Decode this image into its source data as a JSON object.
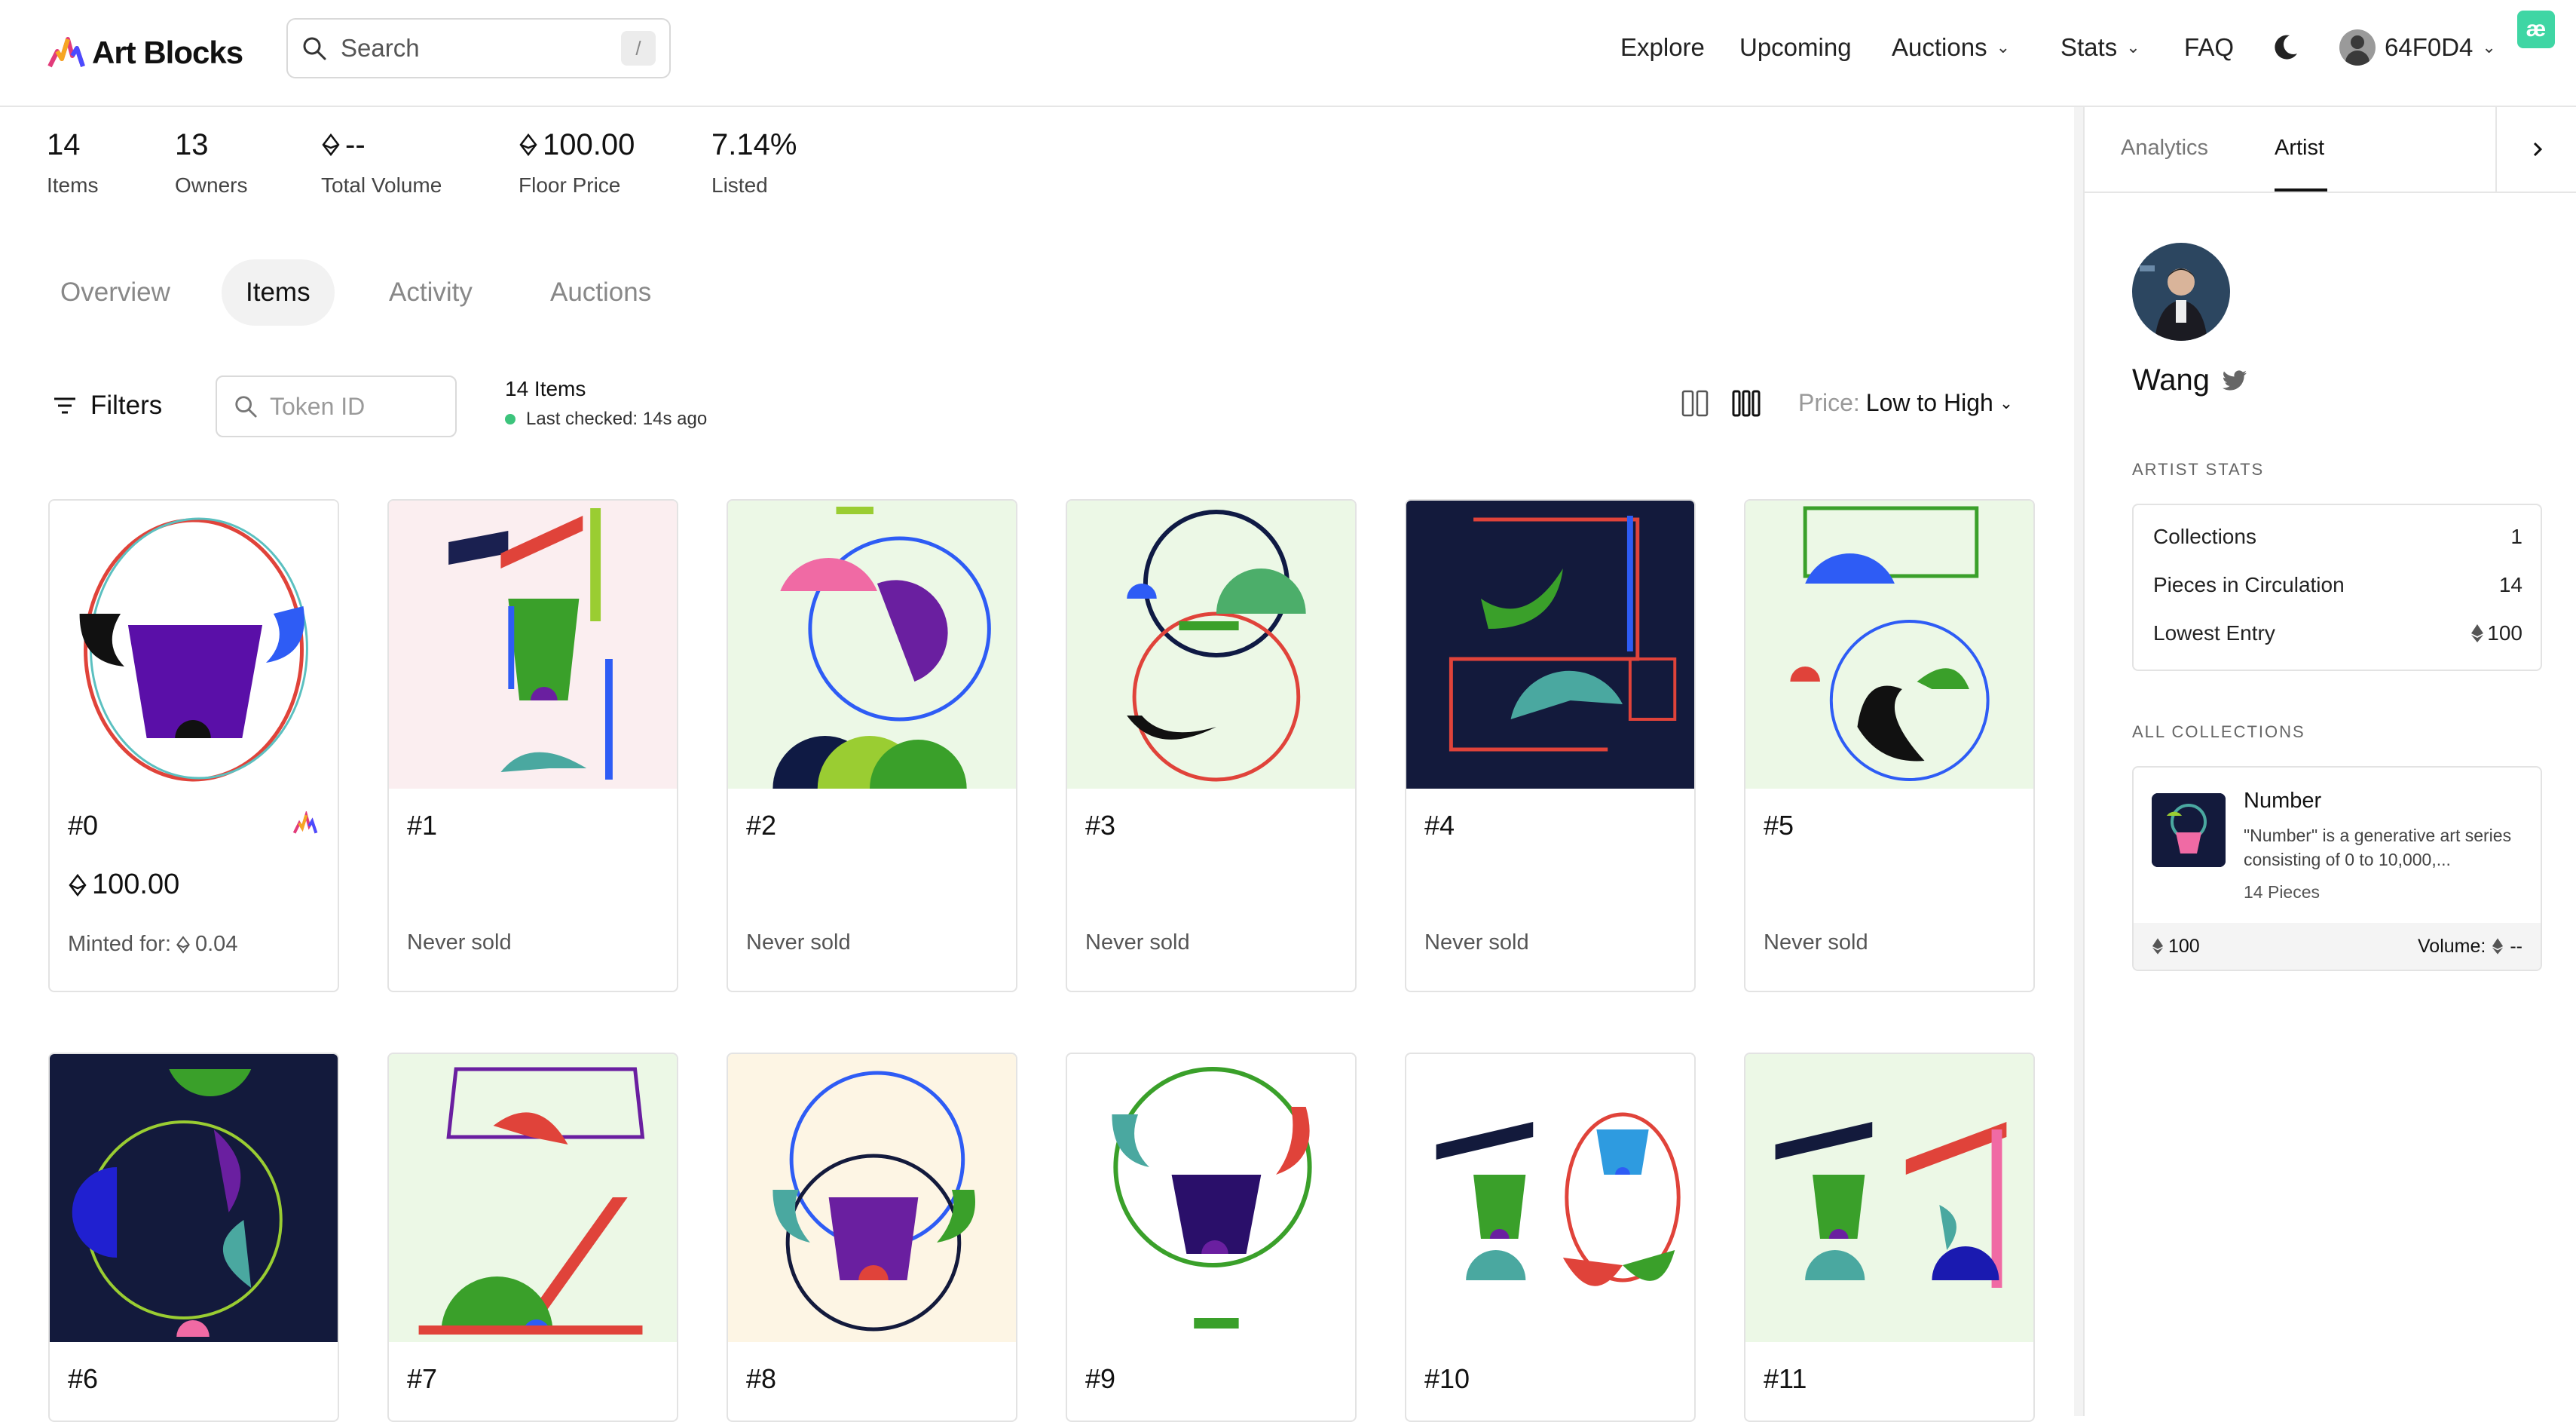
{
  "brand": {
    "name": "Art Blocks"
  },
  "search": {
    "placeholder": "Search",
    "shortcut": "/"
  },
  "nav": {
    "explore": "Explore",
    "upcoming": "Upcoming",
    "auctions": "Auctions",
    "stats": "Stats",
    "faq": "FAQ",
    "account": "64F0D4",
    "badge": "æ"
  },
  "stats": [
    {
      "value": "14",
      "label": "Items"
    },
    {
      "value": "13",
      "label": "Owners"
    },
    {
      "value": "--",
      "label": "Total Volume",
      "eth": true
    },
    {
      "value": "100.00",
      "label": "Floor Price",
      "eth": true
    },
    {
      "value": "7.14%",
      "label": "Listed"
    }
  ],
  "tabs": {
    "overview": "Overview",
    "items": "Items",
    "activity": "Activity",
    "auctions": "Auctions"
  },
  "toolbar": {
    "filters": "Filters",
    "token_placeholder": "Token ID",
    "count": "14 Items",
    "last_checked": "Last checked: 14s ago",
    "sort_label": "Price:",
    "sort_value": "Low to High"
  },
  "items": [
    {
      "num": "#0",
      "price": "100.00",
      "minted_label": "Minted for:",
      "minted": "0.04"
    },
    {
      "num": "#1",
      "sub": "Never sold"
    },
    {
      "num": "#2",
      "sub": "Never sold"
    },
    {
      "num": "#3",
      "sub": "Never sold"
    },
    {
      "num": "#4",
      "sub": "Never sold"
    },
    {
      "num": "#5",
      "sub": "Never sold"
    },
    {
      "num": "#6"
    },
    {
      "num": "#7"
    },
    {
      "num": "#8"
    },
    {
      "num": "#9"
    },
    {
      "num": "#10"
    },
    {
      "num": "#11"
    }
  ],
  "sidebar": {
    "tab_analytics": "Analytics",
    "tab_artist": "Artist",
    "artist_name": "Wang",
    "artist_stats_label": "ARTIST STATS",
    "artist_stats": [
      {
        "label": "Collections",
        "value": "1"
      },
      {
        "label": "Pieces in Circulation",
        "value": "14"
      },
      {
        "label": "Lowest Entry",
        "value": "100",
        "eth": true
      }
    ],
    "all_collections_label": "ALL COLLECTIONS",
    "collection": {
      "title": "Number",
      "description": "\"Number\" is a generative art series consisting of 0 to 10,000,...",
      "pieces": "14 Pieces",
      "floor": "100",
      "volume_label": "Volume:",
      "volume": "--"
    }
  },
  "colors": {
    "accent_green": "#3cc47c",
    "art_navy": "#131a3c",
    "art_green_bg": "#ecf8e6",
    "art_pink_bg": "#fbeef0",
    "art_cream_bg": "#fdf5e4"
  }
}
